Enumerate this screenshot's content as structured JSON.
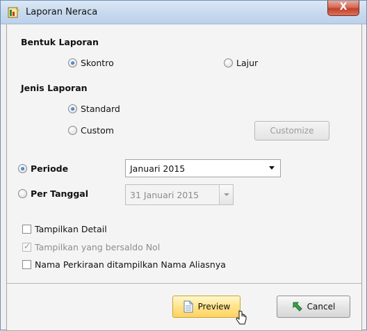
{
  "window": {
    "title": "Laporan Neraca",
    "close_label": "X"
  },
  "bentuk": {
    "label": "Bentuk Laporan",
    "options": [
      {
        "label": "Skontro",
        "selected": true
      },
      {
        "label": "Lajur",
        "selected": false
      }
    ]
  },
  "jenis": {
    "label": "Jenis Laporan",
    "options": [
      {
        "label": "Standard",
        "selected": true
      },
      {
        "label": "Custom",
        "selected": false
      }
    ],
    "customize_label": "Customize"
  },
  "periode": {
    "label": "Periode",
    "selected": true,
    "value": "Januari 2015"
  },
  "per_tanggal": {
    "label": "Per Tanggal",
    "selected": false,
    "value": "31 Januari 2015"
  },
  "options": [
    {
      "label": "Tampilkan Detail",
      "checked": false,
      "disabled": false
    },
    {
      "label": "Tampilkan yang bersaldo Nol",
      "checked": true,
      "disabled": true
    },
    {
      "label": "Nama Perkiraan ditampilkan Nama Aliasnya",
      "checked": false,
      "disabled": false
    }
  ],
  "buttons": {
    "preview_label": "Preview",
    "cancel_label": "Cancel"
  },
  "colors": {
    "title_bar": "#c7d9ee",
    "close": "#c0412c",
    "radio_dot": "#1a56b8",
    "preview_bg": "#ffe48b"
  }
}
